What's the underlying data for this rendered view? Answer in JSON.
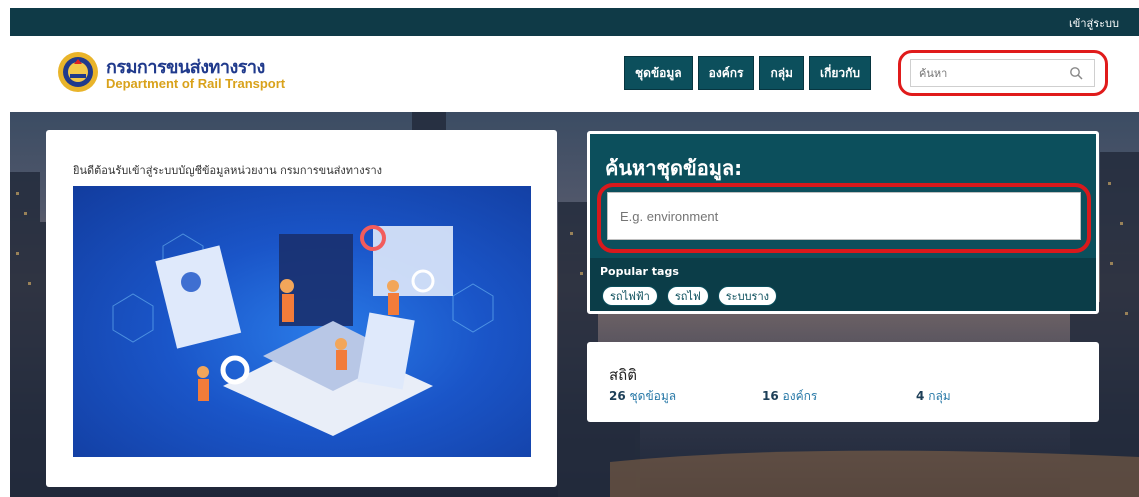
{
  "topbar": {
    "login_label": "เข้าสู่ระบบ"
  },
  "logo": {
    "title_th": "กรมการขนส่งทางราง",
    "title_en": "Department of Rail Transport"
  },
  "nav": {
    "items": [
      {
        "label": "ชุดข้อมูล"
      },
      {
        "label": "องค์กร"
      },
      {
        "label": "กลุ่ม"
      },
      {
        "label": "เกี่ยวกับ"
      }
    ],
    "search_placeholder": "ค้นหา"
  },
  "welcome": {
    "text": "ยินดีต้อนรับเข้าสู่ระบบบัญชีข้อมูลหน่วยงาน กรมการขนส่งทางราง"
  },
  "dataset_search": {
    "title": "ค้นหาชุดข้อมูล:",
    "placeholder": "E.g. environment",
    "tags_label": "Popular tags",
    "tags": [
      {
        "label": "รถไฟฟ้า"
      },
      {
        "label": "รถไฟ"
      },
      {
        "label": "ระบบราง"
      }
    ]
  },
  "stats": {
    "title": "สถิติ",
    "datasets": {
      "count": "26",
      "label": "ชุดข้อมูล"
    },
    "organizations": {
      "count": "16",
      "label": "องค์กร"
    },
    "groups": {
      "count": "4",
      "label": "กลุ่ม"
    }
  },
  "colors": {
    "topbar": "#0f3a47",
    "nav_button": "#0c4f5c",
    "highlight_ring": "#e01b1b",
    "brand_blue": "#203a8c",
    "brand_gold": "#d9a21b"
  }
}
